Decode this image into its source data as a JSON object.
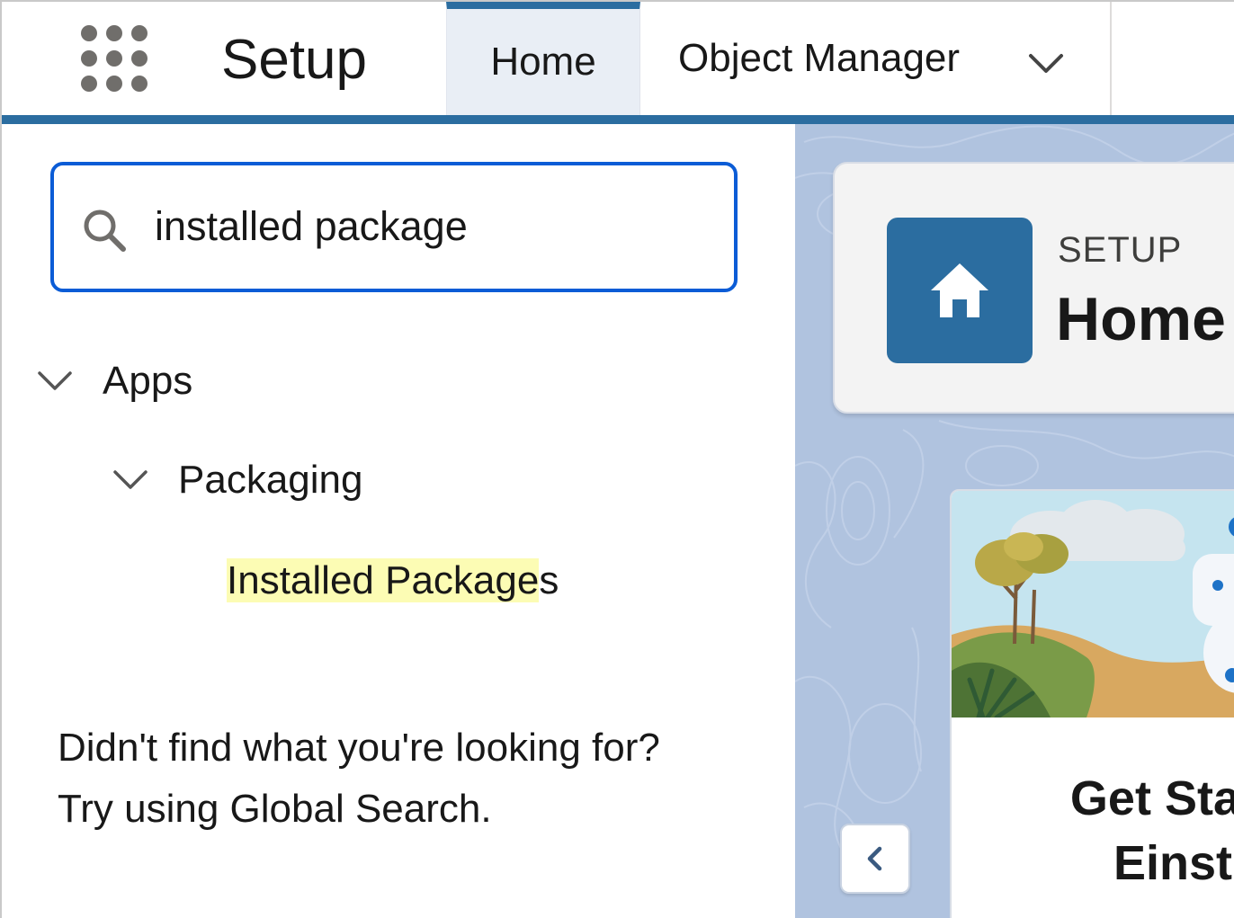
{
  "header": {
    "app_name": "Setup",
    "tabs": [
      {
        "label": "Home",
        "active": true
      },
      {
        "label": "Object Manager",
        "has_dropdown": true
      }
    ]
  },
  "sidebar": {
    "search": {
      "value": "installed package"
    },
    "tree": {
      "group": {
        "label": "Apps",
        "expanded": true
      },
      "subgroup": {
        "label": "Packaging",
        "expanded": true
      },
      "item": {
        "label_highlighted": "Installed Package",
        "label_rest": "s"
      }
    },
    "not_found_line1": "Didn't find what you're looking for?",
    "not_found_line2": "Try using Global Search."
  },
  "main": {
    "header_card": {
      "eyebrow": "SETUP",
      "title": "Home"
    },
    "promo_card": {
      "title_line1": "Get Star",
      "title_line2": "Einste"
    }
  },
  "icons": [
    "app-launcher-icon",
    "chevron-down-icon",
    "search-icon",
    "home-icon",
    "chevron-left-icon"
  ],
  "colors": {
    "brand_blue": "#2b6da0",
    "focus_blue": "#0b5cd6",
    "active_tab_bg": "#e9eef5",
    "right_bg": "#b0c3df",
    "highlight": "#fcfcb4"
  }
}
